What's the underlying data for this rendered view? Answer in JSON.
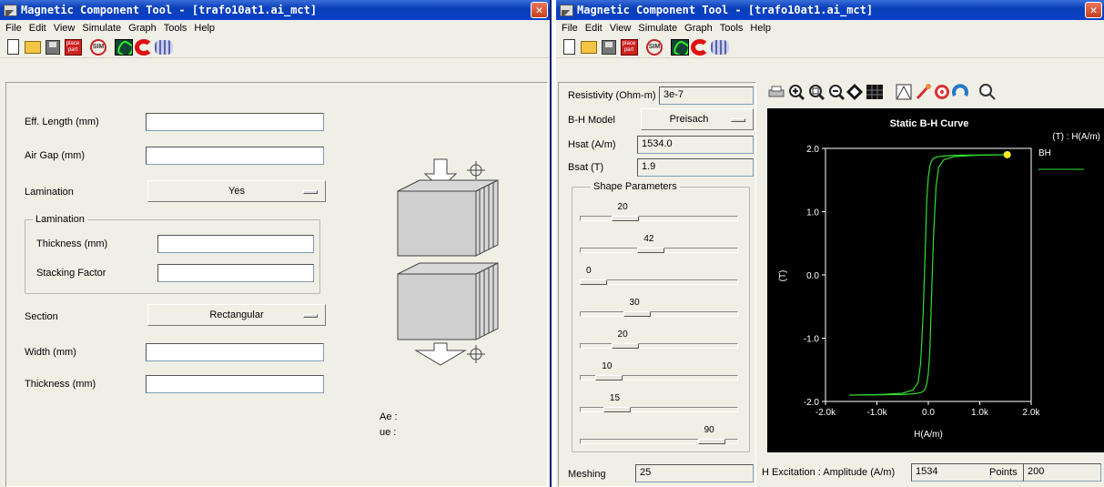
{
  "left": {
    "title": "Magnetic Component Tool - [trafo10at1.ai_mct]",
    "menu": [
      "File",
      "Edit",
      "View",
      "Simulate",
      "Graph",
      "Tools",
      "Help"
    ],
    "toolbar_place_label": "place part",
    "toolbar_sim_label": "SIM",
    "eff_length_label": "Eff. Length (mm)",
    "air_gap_label": "Air Gap (mm)",
    "lamination_label": "Lamination",
    "lamination_value": "Yes",
    "lamination_group_title": "Lamination",
    "thickness_label": "Thickness (mm)",
    "stacking_label": "Stacking Factor",
    "section_label": "Section",
    "section_value": "Rectangular",
    "width_label": "Width (mm)",
    "thickness2_label": "Thickness (mm)",
    "ae_label": "Ae :",
    "ue_label": "ue :",
    "phi_symbol": "Φ"
  },
  "right": {
    "title": "Magnetic Component Tool - [trafo10at1.ai_mct]",
    "menu": [
      "File",
      "Edit",
      "View",
      "Simulate",
      "Graph",
      "Tools",
      "Help"
    ],
    "resistivity_label": "Resistivity (Ohm-m)",
    "resistivity_value": "3e-7",
    "bh_model_label": "B-H Model",
    "bh_model_value": "Preisach",
    "hsat_label": "Hsat (A/m)",
    "hsat_value": "1534.0",
    "bsat_label": "Bsat (T)",
    "bsat_value": "1.9",
    "shape_params_title": "Shape Parameters",
    "sliders": [
      {
        "value": "20",
        "level": 0.24
      },
      {
        "value": "42",
        "level": 0.44
      },
      {
        "value": "0",
        "level": 0.0
      },
      {
        "value": "30",
        "level": 0.33
      },
      {
        "value": "20",
        "level": 0.24
      },
      {
        "value": "10",
        "level": 0.12
      },
      {
        "value": "15",
        "level": 0.18
      },
      {
        "value": "90",
        "level": 0.9
      }
    ],
    "meshing_label": "Meshing",
    "meshing_value": "25",
    "h_excitation_label": "H Excitation : Amplitude (A/m)",
    "h_excitation_value": "1534",
    "points_label": "Points",
    "points_value": "200"
  },
  "chart_data": {
    "type": "line",
    "title": "Static B-H Curve",
    "xlabel": "H(A/m)",
    "ylabel": "(T)",
    "legend_title": "(T) : H(A/m)",
    "legend_placement": "right",
    "xlim": [
      -2000,
      2000
    ],
    "ylim": [
      -2.0,
      2.0
    ],
    "xticks": [
      "-2.0k",
      "-1.0k",
      "0.0",
      "1.0k",
      "2.0k"
    ],
    "yticks": [
      "2.0",
      "1.0",
      "0.0",
      "-1.0",
      "-2.0"
    ],
    "series_color": "#33dd33",
    "marker_color": "#ffee22",
    "series": [
      {
        "name": "BH",
        "x": [
          -1534,
          -900,
          -500,
          -300,
          -200,
          -150,
          -100,
          -60,
          -30,
          0,
          30,
          60,
          100,
          150,
          200,
          300,
          500,
          900,
          1534
        ],
        "upper": [
          -1.9,
          -1.89,
          -1.87,
          -1.82,
          -1.7,
          -1.4,
          -0.6,
          0.4,
          1.2,
          1.55,
          1.72,
          1.8,
          1.84,
          1.86,
          1.87,
          1.88,
          1.89,
          1.895,
          1.9
        ],
        "lower": [
          -1.9,
          -1.895,
          -1.89,
          -1.88,
          -1.87,
          -1.86,
          -1.84,
          -1.8,
          -1.72,
          -1.55,
          -1.2,
          -0.4,
          0.6,
          1.4,
          1.7,
          1.82,
          1.87,
          1.89,
          1.9
        ]
      }
    ],
    "marker": {
      "x": 1534,
      "y": 1.9
    }
  }
}
